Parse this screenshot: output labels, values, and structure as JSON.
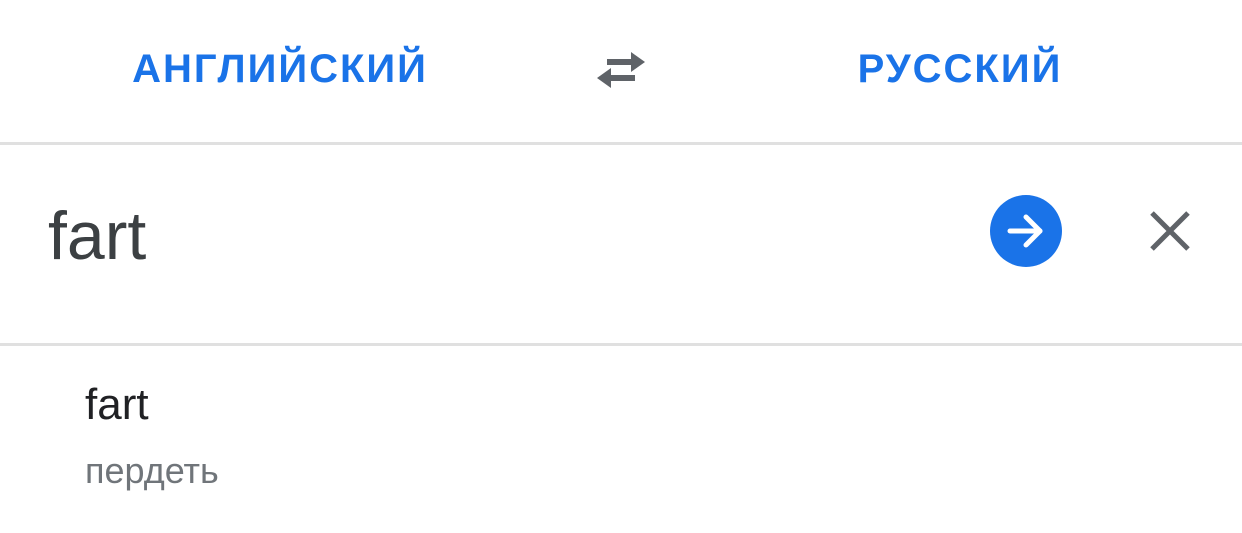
{
  "languages": {
    "source": "АНГЛИЙСКИЙ",
    "target": "РУССКИЙ",
    "swap_icon": "swap-arrows-icon"
  },
  "input": {
    "value": "fart",
    "go_icon": "arrow-forward-icon",
    "clear_icon": "close-icon"
  },
  "suggestion": {
    "term": "fart",
    "translation": "пердеть"
  },
  "colors": {
    "accent": "#1a73e8",
    "icon_gray": "#5f6368",
    "divider": "#e0e0e0"
  }
}
